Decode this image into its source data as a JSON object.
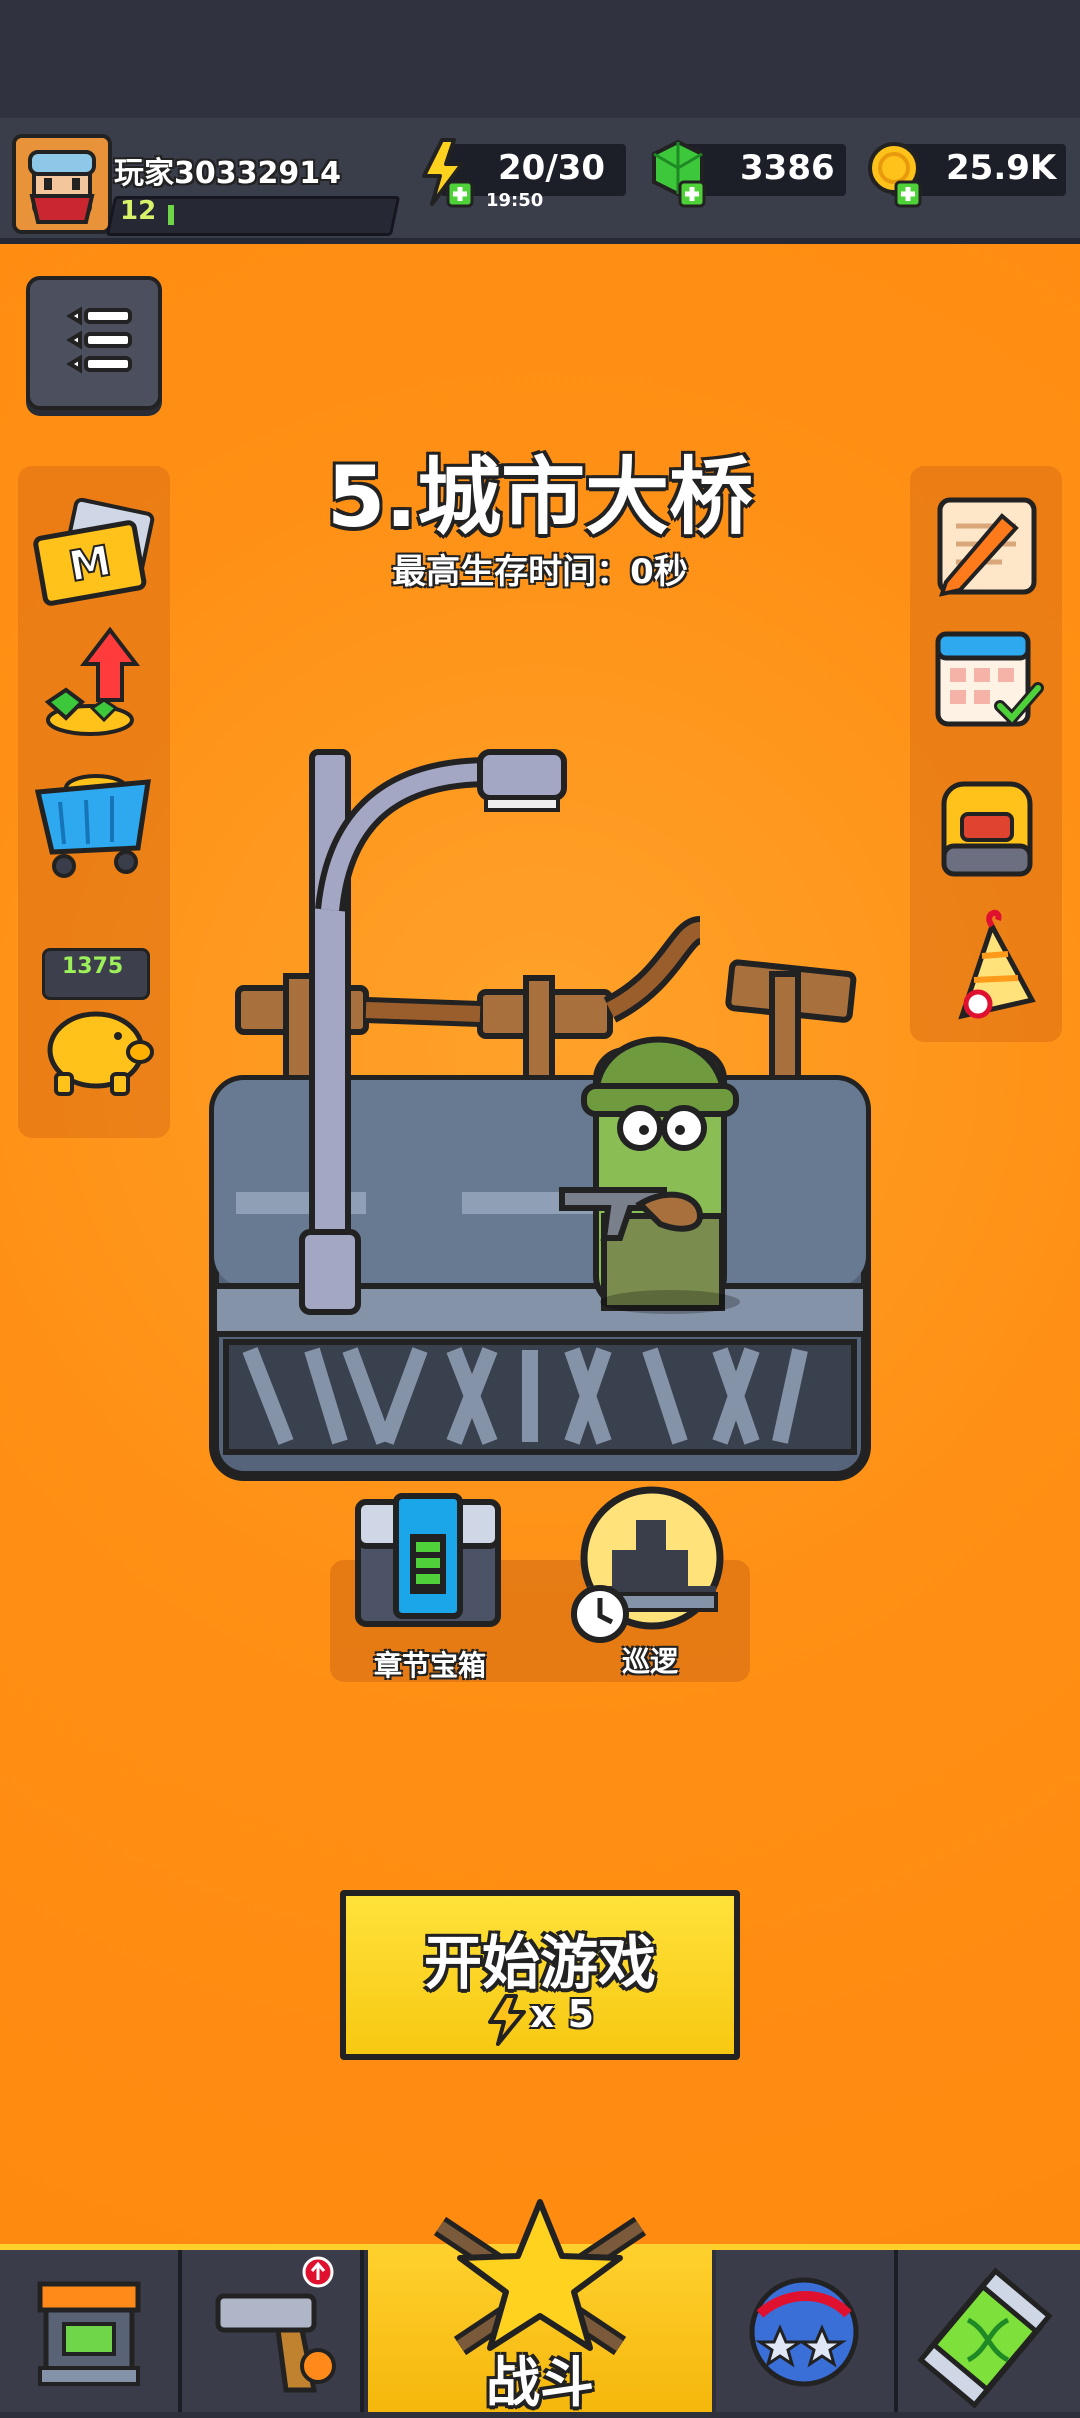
{
  "player": {
    "name": "玩家30332914",
    "level": "12",
    "xp_fraction": 0.02
  },
  "resources": {
    "energy": {
      "value": "20/30",
      "timer": "19:50",
      "icon": "lightning-plus-icon"
    },
    "gems": {
      "value": "3386",
      "icon": "green-gem-plus-icon"
    },
    "coins": {
      "value": "25.9K",
      "icon": "gold-coin-plus-icon"
    }
  },
  "stage": {
    "title": "5.城市大桥",
    "best_time": "最高生存时间：0秒"
  },
  "left_icons": [
    "m-card-icon",
    "gems-upgrade-icon",
    "shop-cart-icon",
    "piggy-bank-icon"
  ],
  "piggy_bank": {
    "value": "1375"
  },
  "right_icons": [
    "notepad-icon",
    "calendar-check-icon",
    "backpack-icon",
    "party-hat-icon"
  ],
  "rewards": {
    "chest_label": "章节宝箱",
    "patrol_label": "巡逻"
  },
  "start": {
    "label": "开始游戏",
    "cost": "x 5"
  },
  "nav": {
    "battle_label": "战斗",
    "tabs": [
      "shop-tab-icon",
      "weapon-tab-icon",
      "battle-tab-icon",
      "talent-tab-icon",
      "gene-tab-icon"
    ]
  },
  "colors": {
    "accent": "#ff9015",
    "button": "#ffd524",
    "dark": "#3a3d4a"
  }
}
